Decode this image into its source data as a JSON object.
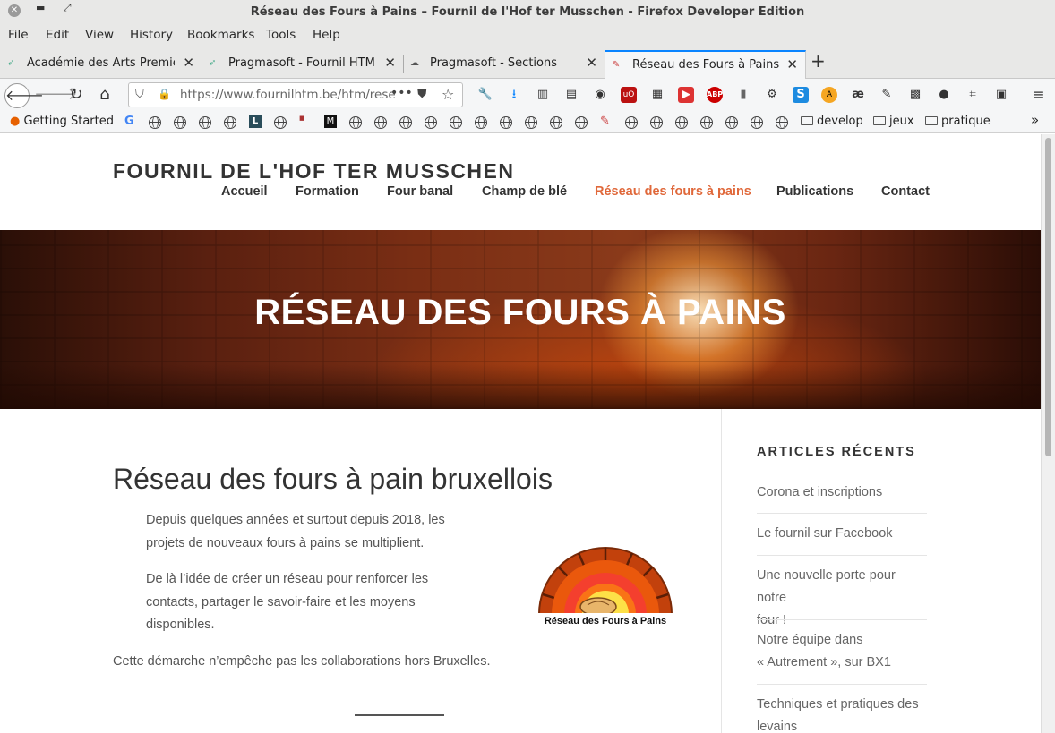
{
  "window": {
    "title": "Réseau des Fours à Pains – Fournil de l'Hof ter Musschen - Firefox Developer Edition"
  },
  "menu": [
    "File",
    "Edit",
    "View",
    "History",
    "Bookmarks",
    "Tools",
    "Help"
  ],
  "tabs": [
    {
      "label": "Académie des Arts Premier",
      "active": false
    },
    {
      "label": "Pragmasoft - Fournil HTM",
      "active": false
    },
    {
      "label": "Pragmasoft - Sections",
      "active": false
    },
    {
      "label": "Réseau des Fours à Pains – F",
      "active": true
    }
  ],
  "urlbar": {
    "url": "https://www.fournilhtm.be/htm/rese"
  },
  "bookmarks": {
    "first": "Getting Started",
    "folders": [
      "develop",
      "jeux",
      "pratique"
    ],
    "chevron": "»"
  },
  "site": {
    "title": "FOURNIL DE L'HOF TER MUSSCHEN",
    "nav": [
      "Accueil",
      "Formation",
      "Four banal",
      "Champ de blé",
      "Réseau des fours à pains",
      "Publications",
      "Contact"
    ],
    "current_nav": "Réseau des fours à pains"
  },
  "hero": {
    "title": "RÉSEAU DES FOURS À PAINS"
  },
  "post": {
    "title": "Réseau des fours à pain bruxellois",
    "paragraphs": [
      [
        "Depuis quelques années et surtout depuis 2018, les",
        "projets de nouveaux fours à pains se multiplient."
      ],
      [
        "De là l’idée de créer un réseau pour renforcer les",
        "contacts, partager le savoir-faire et les moyens",
        "disponibles."
      ],
      [
        "Cette démarche n’empêche pas les collaborations hors Bruxelles."
      ]
    ],
    "logo_caption": "Réseau des Fours à Pains"
  },
  "sidebar": {
    "heading": "ARTICLES RÉCENTS",
    "items": [
      [
        "Corona et inscriptions"
      ],
      [
        "Le fournil sur Facebook"
      ],
      [
        "Une nouvelle porte pour notre",
        "four !"
      ],
      [
        "Notre équipe dans",
        "« Autrement », sur BX1"
      ],
      [
        "Techniques et pratiques des",
        "levains"
      ]
    ]
  },
  "colors": {
    "accent": "#e0683a",
    "text": "#333333",
    "tab_highlight": "#0a84ff"
  }
}
